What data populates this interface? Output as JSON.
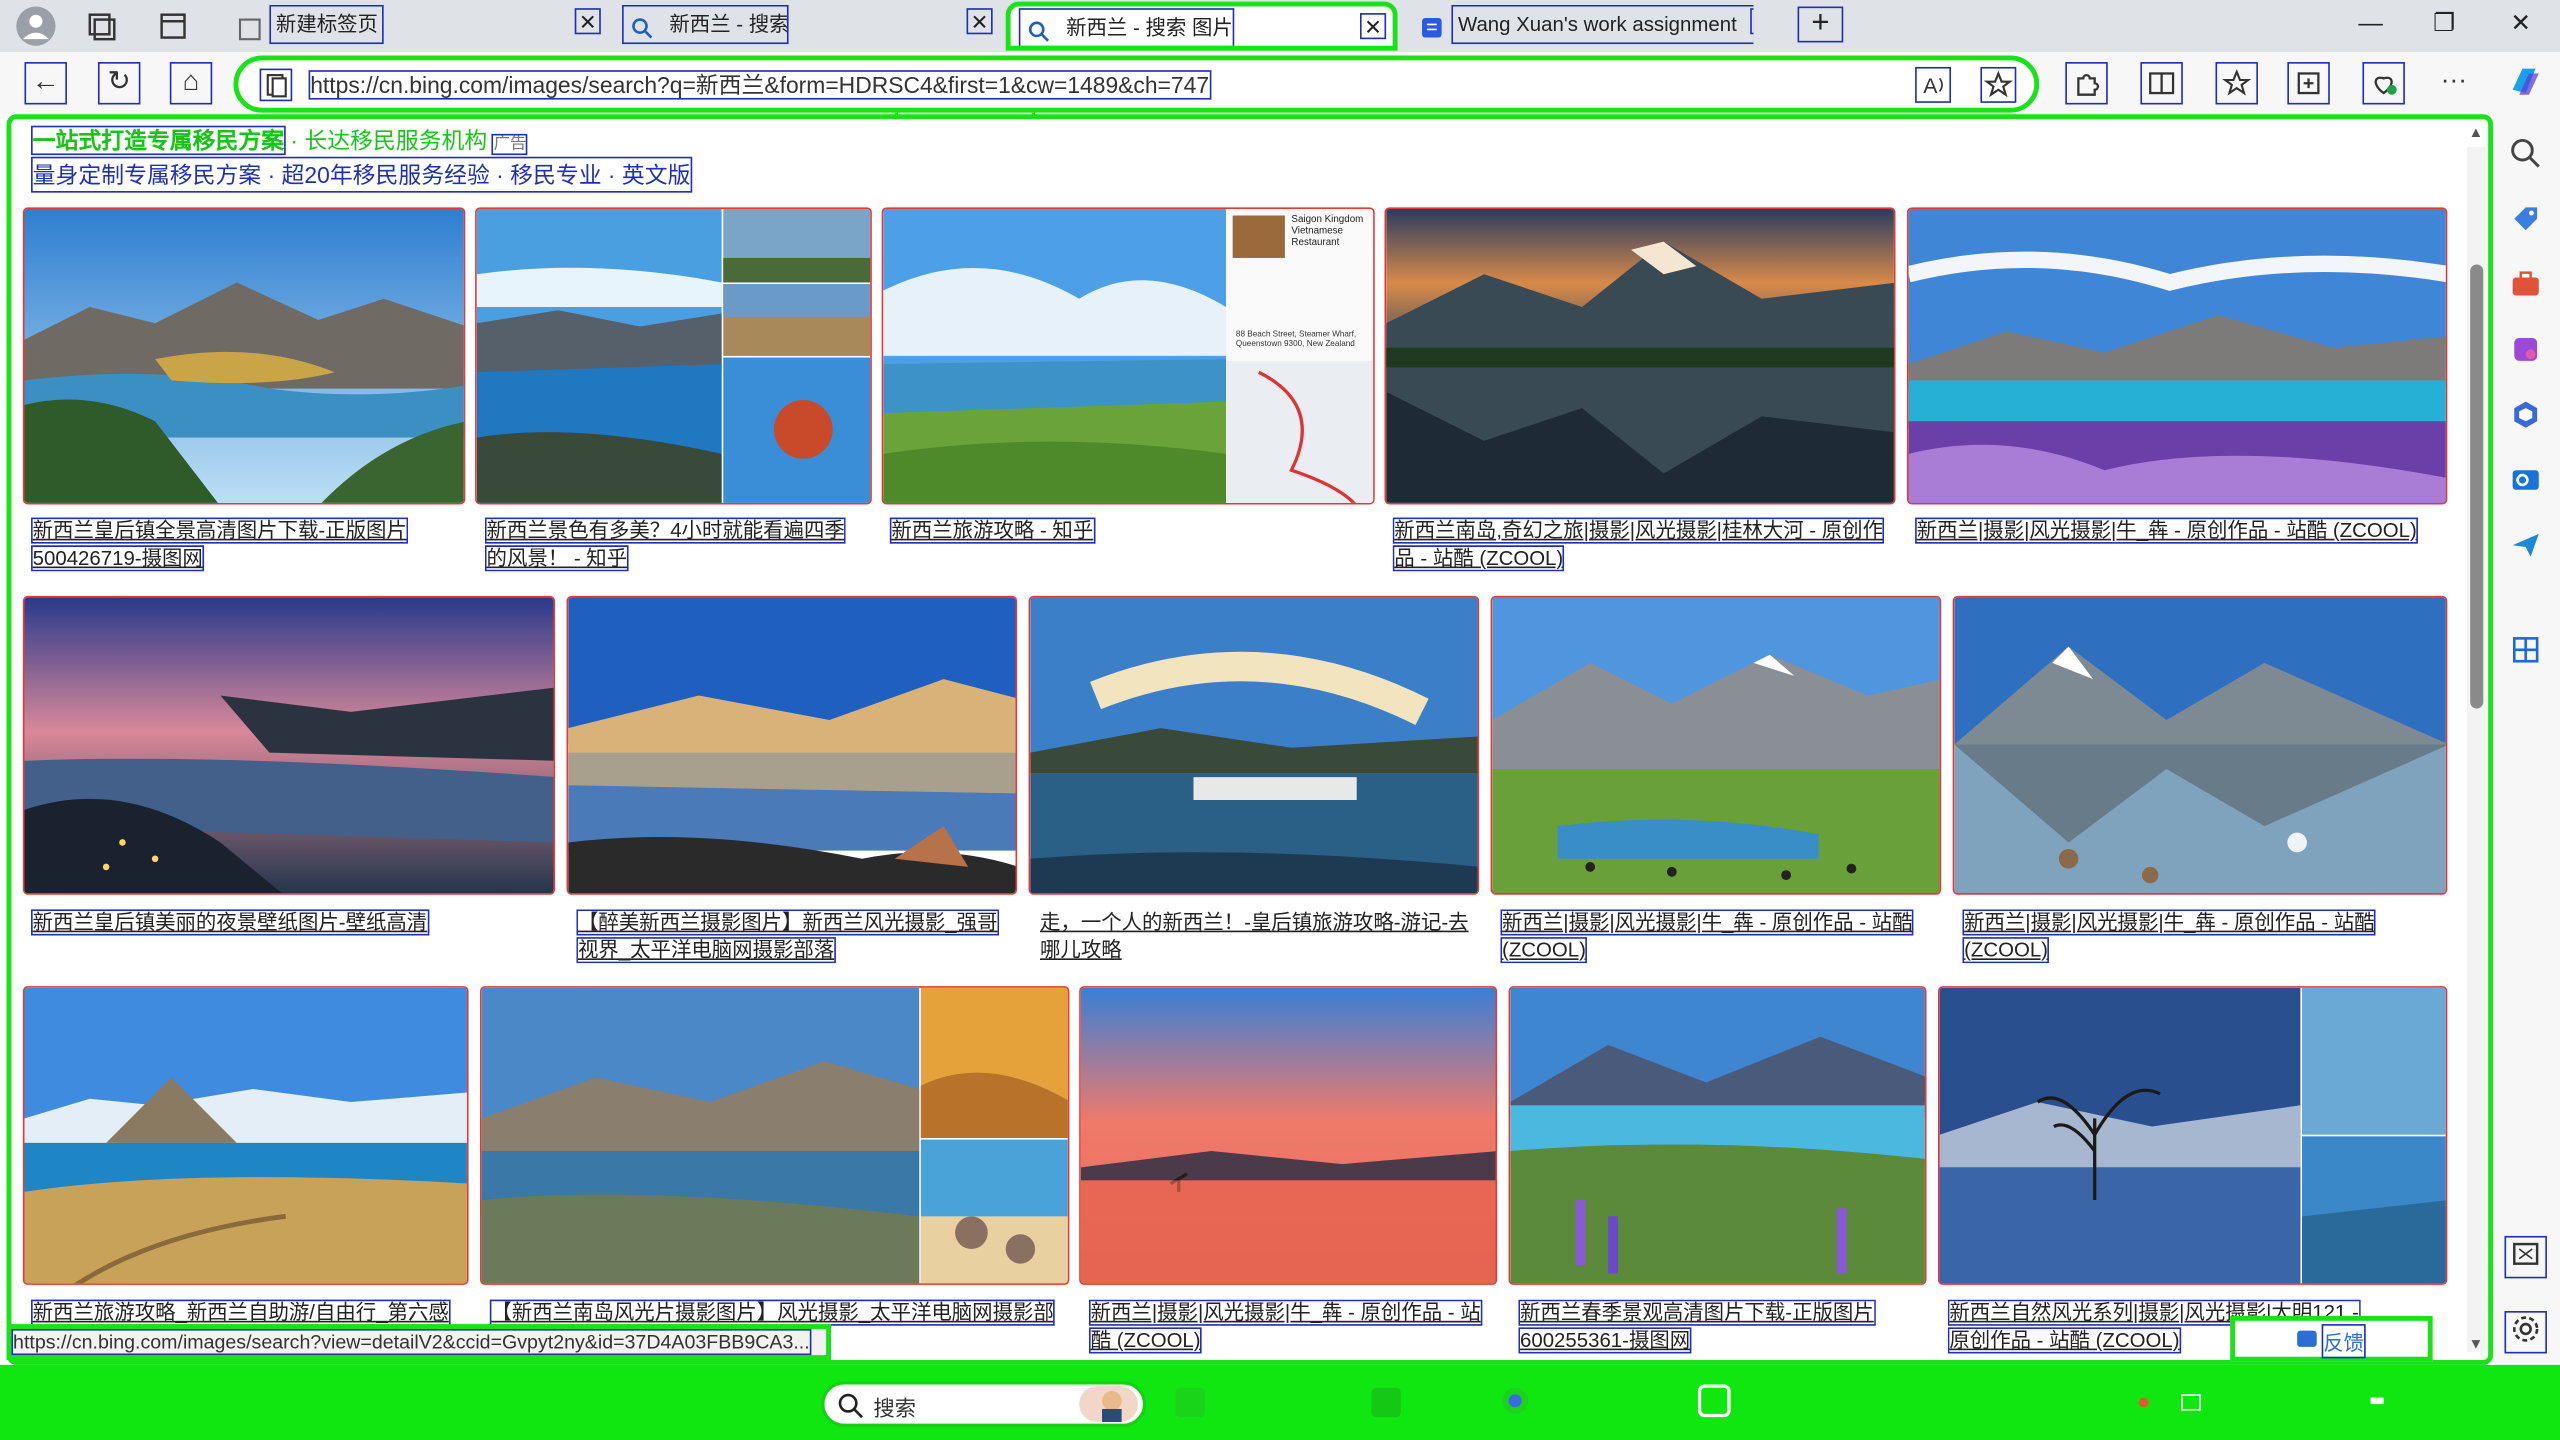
{
  "tabs": [
    {
      "title": "新建标签页",
      "close": "✕"
    },
    {
      "title": "新西兰 - 搜索",
      "close": "✕"
    },
    {
      "title": "新西兰 - 搜索 图片",
      "close": "✕"
    },
    {
      "title": "Wang Xuan's work assignment",
      "close": "✕"
    }
  ],
  "new_tab": "+",
  "window": {
    "minimize": "—",
    "maximize": "❐",
    "close": "✕"
  },
  "toolbar": {
    "back": "←",
    "refresh": "↻",
    "home": "⌂",
    "more": "···"
  },
  "address": {
    "url": "https://cn.bing.com/images/search?q=新西兰&form=HDRSC4&first=1&cw=1489&ch=747"
  },
  "ad": {
    "line1_a": "一站式打造专属移民方案",
    "line1_b": "· 长达移民服务机构",
    "ad_tag": "广告",
    "line2": "量身定制专属移民方案 · 超20年移民服务经验 · 移民专业 · 英文版"
  },
  "captions": {
    "r1": [
      "新西兰皇后镇全景高清图片下载-正版图片500426719-摄图网",
      "新西兰景色有多美？4小时就能看遍四季的风景！ - 知乎",
      "新西兰旅游攻略 - 知乎",
      "新西兰南岛,奇幻之旅|摄影|风光摄影|桂林大河 - 原创作品 - 站酷 (ZCOOL)",
      "新西兰|摄影|风光摄影|牛_犇 - 原创作品 - 站酷 (ZCOOL)"
    ],
    "r2": [
      "新西兰皇后镇美丽的夜景壁纸图片-壁纸高清",
      "【醉美新西兰摄影图片】新西兰风光摄影_强哥视界_太平洋电脑网摄影部落",
      "走，一个人的新西兰！-皇后镇旅游攻略-游记-去哪儿攻略",
      "新西兰|摄影|风光摄影|牛_犇 - 原创作品 - 站酷 (ZCOOL)",
      "新西兰|摄影|风光摄影|牛_犇 - 原创作品 - 站酷 (ZCOOL)"
    ],
    "r3": [
      "新西兰旅游攻略_新西兰自助游/自由行_第六感",
      "【新西兰南岛风光片摄影图片】风光摄影_太平洋电脑网摄影部",
      "新西兰|摄影|风光摄影|牛_犇 - 原创作品 - 站酷 (ZCOOL)",
      "新西兰春季景观高清图片下载-正版图片600255361-摄图网",
      "新西兰自然风光系列|摄影|风光摄影|大明121 - 原创作品 - 站酷 (ZCOOL)"
    ]
  },
  "overlay": {
    "restaurant_name": "Saigon Kingdom Vietnamese Restaurant",
    "restaurant_addr": "88 Beach Street, Steamer Wharf, Queenstown 9300, New Zealand"
  },
  "status_url": "https://cn.bing.com/images/search?view=detailV2&ccid=Gvpyt2ny&id=37D4A03FBB9CA3...",
  "feedback": "反馈",
  "taskbar": {
    "search_placeholder": "搜索"
  },
  "colors": {
    "annotation_green": "#18e318",
    "annotation_blue": "#1f2fb8",
    "annotation_red": "#e53935"
  }
}
